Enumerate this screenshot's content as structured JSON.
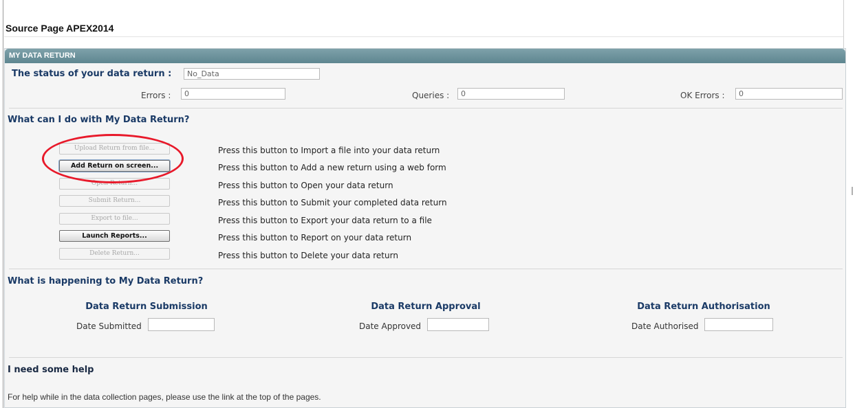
{
  "page": {
    "title": "Source Page APEX2014"
  },
  "panel": {
    "header": "MY DATA RETURN"
  },
  "status": {
    "label": "The status of your data return :",
    "value": "No_Data",
    "errors_label": "Errors :",
    "errors_value": "0",
    "queries_label": "Queries :",
    "queries_value": "0",
    "ok_errors_label": "OK Errors :",
    "ok_errors_value": "0"
  },
  "actions": {
    "heading": "What can I do with My Data Return?",
    "items": [
      {
        "button": "Upload Return from file...",
        "enabled": false,
        "description": "Press this button to Import a file into your data return"
      },
      {
        "button": "Add Return on screen...",
        "enabled": true,
        "description": "Press this button to Add a new return using a web form"
      },
      {
        "button": "Open Return...",
        "enabled": false,
        "description": "Press this button to Open your data return"
      },
      {
        "button": "Submit Return...",
        "enabled": false,
        "description": "Press this button to Submit your completed data return"
      },
      {
        "button": "Export to file...",
        "enabled": false,
        "description": "Press this button to Export your data return to a file"
      },
      {
        "button": "Launch Reports...",
        "enabled": true,
        "description": "Press this button to Report on your data return"
      },
      {
        "button": "Delete Return...",
        "enabled": false,
        "description": "Press this button to Delete your data return"
      }
    ]
  },
  "happening": {
    "heading": "What is happening to My Data Return?",
    "submission": {
      "title": "Data Return Submission",
      "label": "Date Submitted",
      "value": ""
    },
    "approval": {
      "title": "Data Return Approval",
      "label": "Date Approved",
      "value": ""
    },
    "authorisation": {
      "title": "Data Return Authorisation",
      "label": "Date Authorised",
      "value": ""
    }
  },
  "help": {
    "heading": "I need some help",
    "text": "For help while in the data collection pages, please use the link at the top of the pages."
  },
  "colors": {
    "header_bar": "#6f95a0",
    "heading_navy": "#1a3a66",
    "annotation_red": "#e8192a"
  }
}
